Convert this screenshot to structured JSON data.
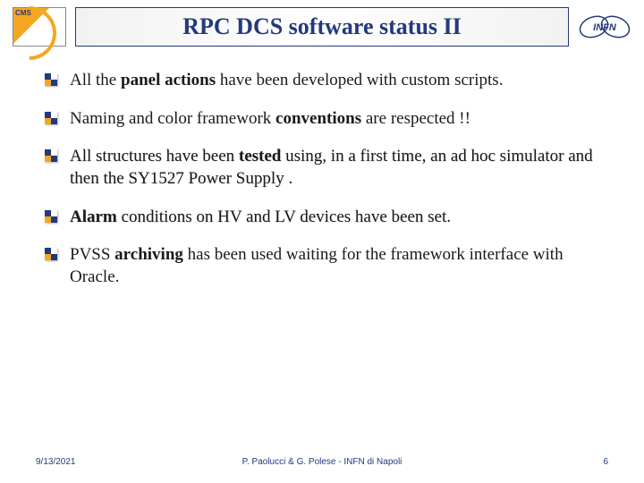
{
  "logos": {
    "cms_label": "CMS",
    "infn_label": "INFN"
  },
  "title": "RPC DCS software status II",
  "bullets": [
    {
      "pre": "All the ",
      "bold1": "panel actions",
      "mid": " have been developed with custom scripts.",
      "shadow": false
    },
    {
      "pre": "Naming and color framework ",
      "bold1": "conventions",
      "mid": " are respected !!",
      "shadow": false
    },
    {
      "pre": "All structures have been ",
      "bold1": "tested",
      "mid": " using, in a first time, an ad hoc simulator and then the SY1527 Power Supply .",
      "shadow": true
    },
    {
      "pre": "",
      "bold1": "Alarm",
      "mid": " conditions on HV and LV devices have been set.",
      "shadow": true
    },
    {
      "pre": "PVSS ",
      "bold1": "archiving",
      "mid": " has been used waiting for the framework interface with Oracle.",
      "shadow": false
    }
  ],
  "footer": {
    "date": "9/13/2021",
    "center": "P. Paolucci & G. Polese - INFN di Napoli",
    "page": "6"
  }
}
